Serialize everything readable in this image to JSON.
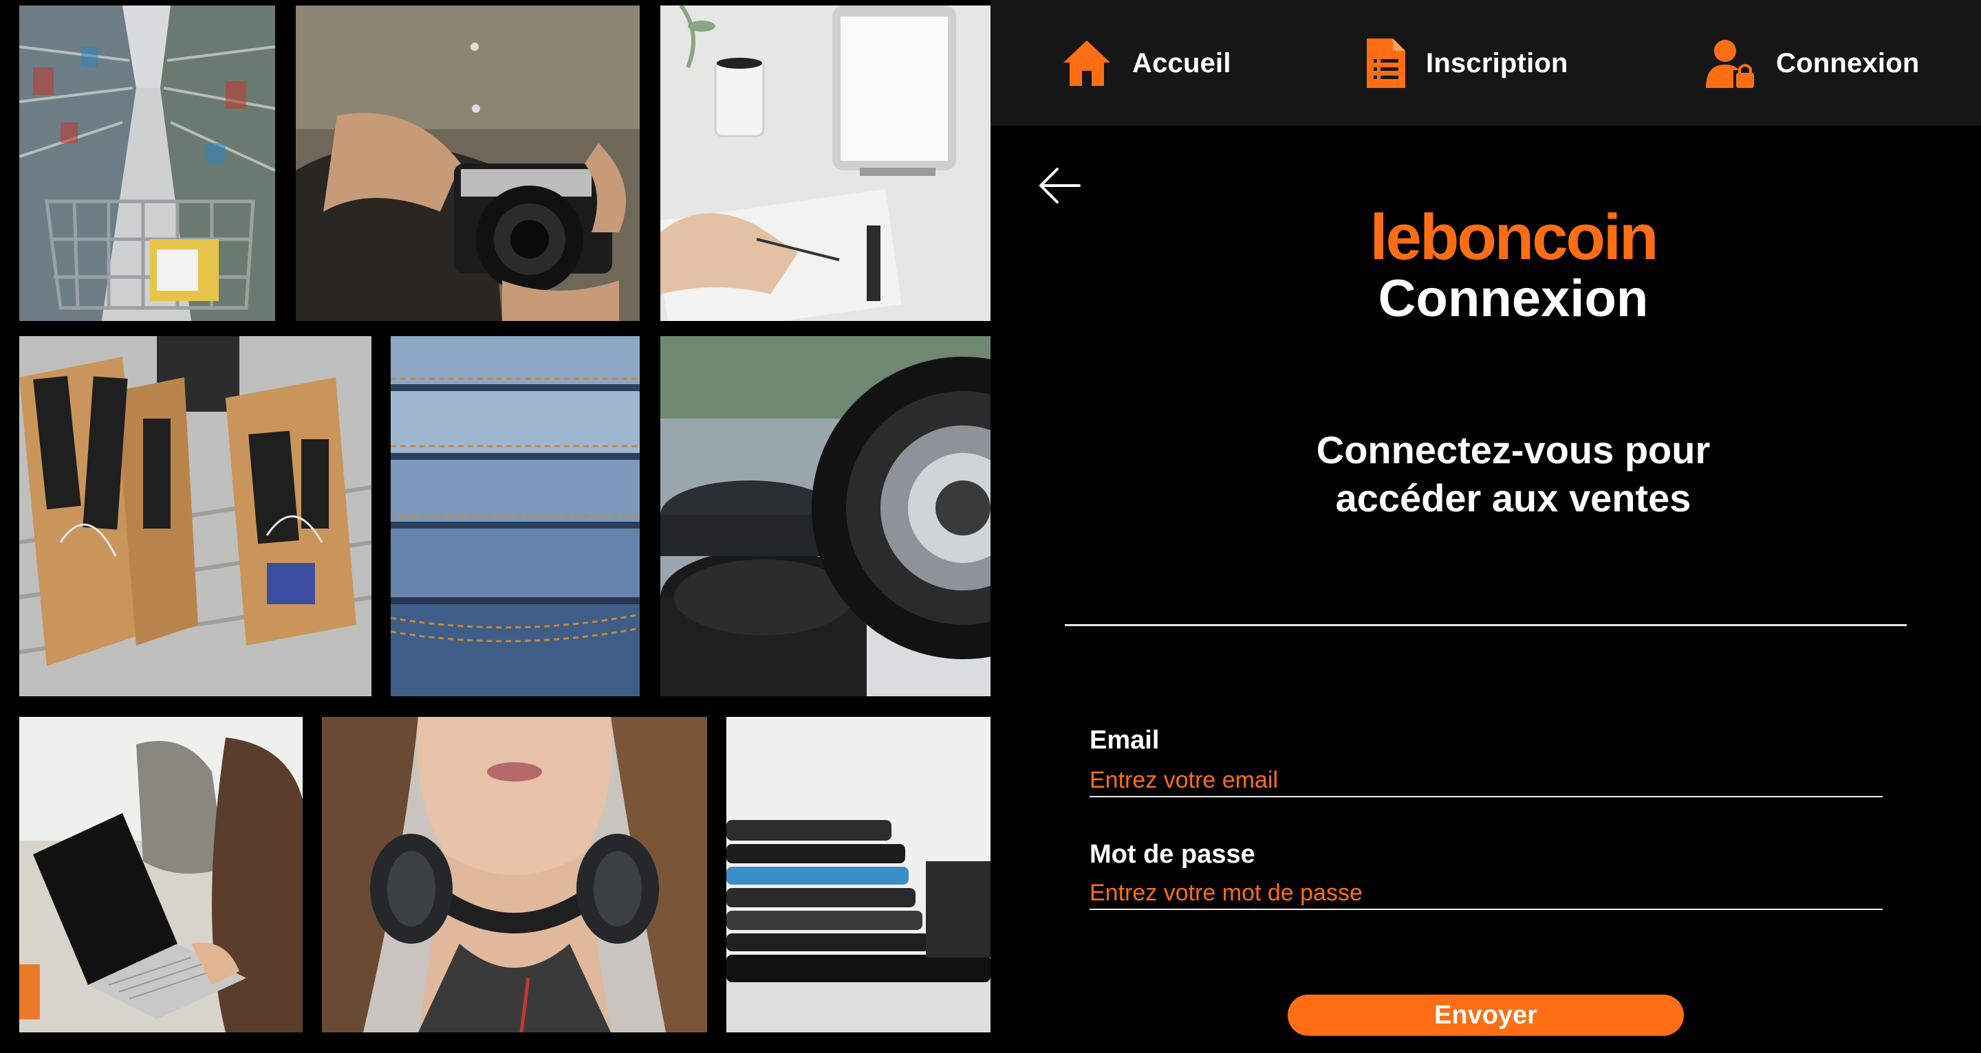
{
  "nav": {
    "items": [
      {
        "label": "Accueil",
        "icon": "home-icon"
      },
      {
        "label": "Inscription",
        "icon": "document-icon"
      },
      {
        "label": "Connexion",
        "icon": "user-lock-icon"
      }
    ]
  },
  "brand": {
    "logo": "leboncoin",
    "accent_color": "#ff6e14"
  },
  "page": {
    "title": "Connexion",
    "subtitle_line1": "Connectez-vous pour",
    "subtitle_line2": "accéder aux ventes"
  },
  "form": {
    "email_label": "Email",
    "email_placeholder": "Entrez votre email",
    "password_label": "Mot de passe",
    "password_placeholder": "Entrez votre mot de passe",
    "submit_label": "Envoyer"
  },
  "collage": {
    "photos": [
      "supermarket-aisle-photo",
      "camera-in-hands-photo",
      "tablet-and-mug-photo",
      "shopping-bags-photo",
      "folded-jeans-photo",
      "camera-lens-photo",
      "laptop-user-photo",
      "headphones-woman-photo",
      "stacked-phones-photo"
    ]
  }
}
